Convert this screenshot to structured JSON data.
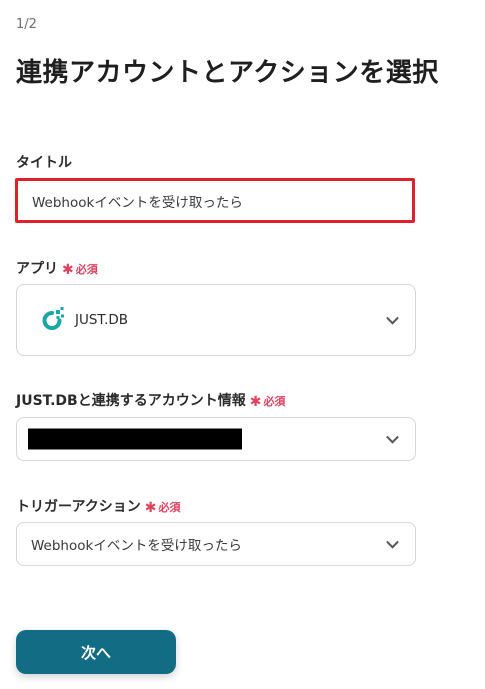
{
  "step_indicator": "1/2",
  "page_title": "連携アカウントとアクションを選択",
  "required_mark": "必須",
  "title_field": {
    "label": "タイトル",
    "value": "Webhookイベントを受け取ったら"
  },
  "app_field": {
    "label": "アプリ",
    "value": "JUST.DB",
    "icon": "justdb-logo-icon"
  },
  "account_field": {
    "label": "JUST.DBと連携するアカウント情報",
    "value_redacted": true
  },
  "trigger_field": {
    "label": "トリガーアクション",
    "value": "Webhookイベントを受け取ったら"
  },
  "next_button": {
    "label": "次へ"
  },
  "colors": {
    "accent": "#126c84",
    "required": "#e0425f",
    "highlight_border": "#e0202c",
    "logo": "#1aa5a8"
  }
}
